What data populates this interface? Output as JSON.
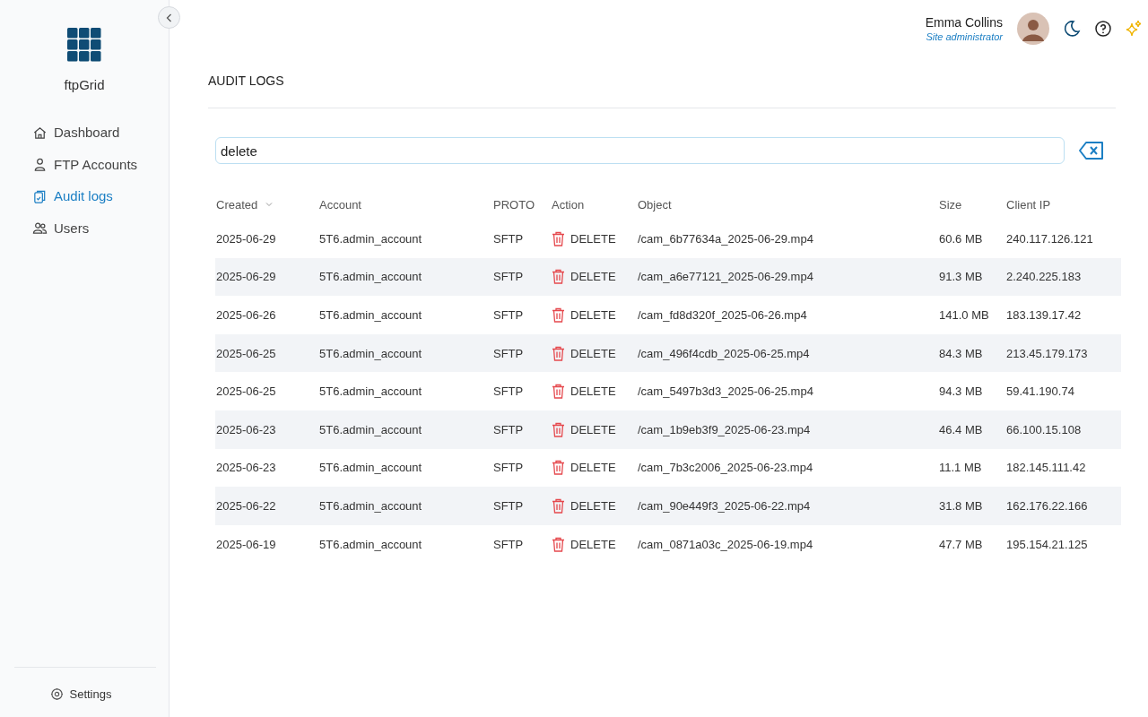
{
  "sidebar": {
    "brand": "ftpGrid",
    "items": [
      {
        "label": "Dashboard",
        "selected": false
      },
      {
        "label": "FTP Accounts",
        "selected": false
      },
      {
        "label": "Audit logs",
        "selected": true
      },
      {
        "label": "Users",
        "selected": false
      }
    ],
    "settings": "Settings"
  },
  "header": {
    "user_name": "Emma Collins",
    "user_role": "Site administrator"
  },
  "page_title": "AUDIT LOGS",
  "search": {
    "value": "delete"
  },
  "table": {
    "columns": [
      {
        "label": "Created",
        "sorted": true
      },
      {
        "label": "Account",
        "sorted": false
      },
      {
        "label": "PROTO",
        "sorted": false
      },
      {
        "label": "Action",
        "sorted": false
      },
      {
        "label": "Object",
        "sorted": false
      },
      {
        "label": "Size",
        "sorted": false
      },
      {
        "label": "Client IP",
        "sorted": false
      }
    ],
    "rows": [
      {
        "created": "2025-06-29",
        "account": "5T6.admin_account",
        "proto": "SFTP",
        "action": "DELETE",
        "object": "/cam_6b77634a_2025-06-29.mp4",
        "size": "60.6 MB",
        "client_ip": "240.117.126.121"
      },
      {
        "created": "2025-06-29",
        "account": "5T6.admin_account",
        "proto": "SFTP",
        "action": "DELETE",
        "object": "/cam_a6e77121_2025-06-29.mp4",
        "size": "91.3 MB",
        "client_ip": "2.240.225.183"
      },
      {
        "created": "2025-06-26",
        "account": "5T6.admin_account",
        "proto": "SFTP",
        "action": "DELETE",
        "object": "/cam_fd8d320f_2025-06-26.mp4",
        "size": "141.0 MB",
        "client_ip": "183.139.17.42"
      },
      {
        "created": "2025-06-25",
        "account": "5T6.admin_account",
        "proto": "SFTP",
        "action": "DELETE",
        "object": "/cam_496f4cdb_2025-06-25.mp4",
        "size": "84.3 MB",
        "client_ip": "213.45.179.173"
      },
      {
        "created": "2025-06-25",
        "account": "5T6.admin_account",
        "proto": "SFTP",
        "action": "DELETE",
        "object": "/cam_5497b3d3_2025-06-25.mp4",
        "size": "94.3 MB",
        "client_ip": "59.41.190.74"
      },
      {
        "created": "2025-06-23",
        "account": "5T6.admin_account",
        "proto": "SFTP",
        "action": "DELETE",
        "object": "/cam_1b9eb3f9_2025-06-23.mp4",
        "size": "46.4 MB",
        "client_ip": "66.100.15.108"
      },
      {
        "created": "2025-06-23",
        "account": "5T6.admin_account",
        "proto": "SFTP",
        "action": "DELETE",
        "object": "/cam_7b3c2006_2025-06-23.mp4",
        "size": "11.1 MB",
        "client_ip": "182.145.111.42"
      },
      {
        "created": "2025-06-22",
        "account": "5T6.admin_account",
        "proto": "SFTP",
        "action": "DELETE",
        "object": "/cam_90e449f3_2025-06-22.mp4",
        "size": "31.8 MB",
        "client_ip": "162.176.22.166"
      },
      {
        "created": "2025-06-19",
        "account": "5T6.admin_account",
        "proto": "SFTP",
        "action": "DELETE",
        "object": "/cam_0871a03c_2025-06-19.mp4",
        "size": "47.7 MB",
        "client_ip": "195.154.21.125"
      }
    ]
  }
}
